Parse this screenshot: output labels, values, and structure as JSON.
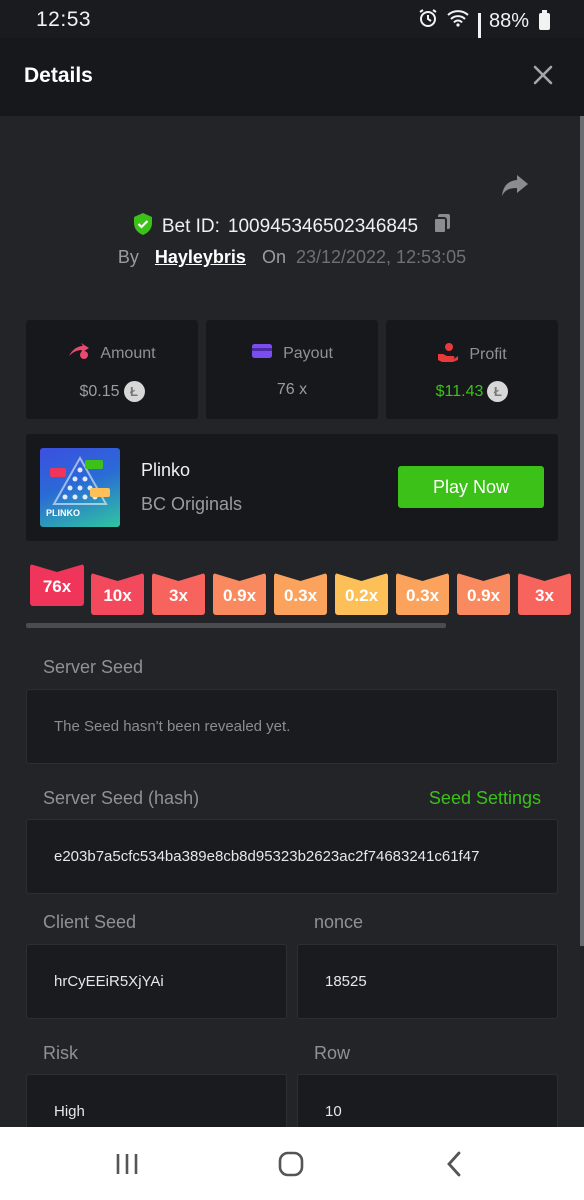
{
  "status_bar": {
    "time": "12:53",
    "battery": "88%"
  },
  "header": {
    "title": "Details"
  },
  "bet": {
    "id_label": "Bet ID:",
    "id": "100945346502346845",
    "by_label": "By",
    "user": "Hayleybris",
    "on_label": "On",
    "datetime": "23/12/2022, 12:53:05"
  },
  "stats": {
    "amount_label": "Amount",
    "amount_value": "$0.15",
    "payout_label": "Payout",
    "payout_value": "76 x",
    "profit_label": "Profit",
    "profit_value": "$11.43"
  },
  "game": {
    "name": "Plinko",
    "provider": "BC Originals",
    "thumb_label": "PLINKO",
    "play_button": "Play Now"
  },
  "multipliers": [
    {
      "label": "76x",
      "color": "#f0355a",
      "active": true
    },
    {
      "label": "10x",
      "color": "#f24a5c",
      "active": false
    },
    {
      "label": "3x",
      "color": "#f7645e",
      "active": false
    },
    {
      "label": "0.9x",
      "color": "#f98a5f",
      "active": false
    },
    {
      "label": "0.3x",
      "color": "#fba35c",
      "active": false
    },
    {
      "label": "0.2x",
      "color": "#fdbf57",
      "active": false
    },
    {
      "label": "0.3x",
      "color": "#fba35c",
      "active": false
    },
    {
      "label": "0.9x",
      "color": "#f98a5f",
      "active": false
    },
    {
      "label": "3x",
      "color": "#f7645e",
      "active": false
    }
  ],
  "fields": {
    "server_seed_label": "Server Seed",
    "server_seed_value": "The Seed hasn't been revealed yet.",
    "server_seed_hash_label": "Server Seed (hash)",
    "seed_settings_link": "Seed Settings",
    "server_seed_hash_value": "e203b7a5cfc534ba389e8cb8d95323b2623ac2f74683241c61f47",
    "client_seed_label": "Client Seed",
    "client_seed_value": "hrCyEEiR5XjYAi",
    "nonce_label": "nonce",
    "nonce_value": "18525",
    "risk_label": "Risk",
    "risk_value": "High",
    "row_label": "Row",
    "row_value": "10"
  },
  "colors": {
    "accent_green": "#3bc117",
    "background": "#232428",
    "card": "#17181b"
  },
  "icons": [
    "alarm-icon",
    "wifi-icon",
    "signal-icon",
    "battery-icon",
    "close-icon",
    "share-icon",
    "shield-check-icon",
    "copy-icon",
    "amount-icon",
    "payout-card-icon",
    "profit-hand-icon",
    "ltc-coin-icon",
    "recents-icon",
    "home-icon",
    "back-icon"
  ]
}
